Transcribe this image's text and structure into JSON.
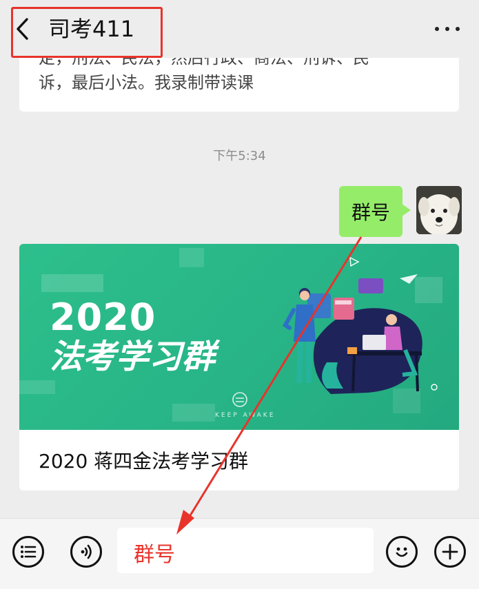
{
  "header": {
    "title": "司考411"
  },
  "messages": {
    "partial_text_line1": "定，刑法、民法，然后行政、商法、刑诉、民",
    "partial_text_line2": "诉，最后小法。我录制带读课",
    "time": "下午5:34",
    "bubble": "群号",
    "card_year": "2020",
    "card_banner_title": "法考学习群",
    "card_brand": "KEEP AWAKE",
    "card_title": "2020 蒋四金法考学习群"
  },
  "input": {
    "value": "群号"
  },
  "colors": {
    "bubble": "#95ec69",
    "banner": "#27b386",
    "highlight": "#e8332b"
  }
}
